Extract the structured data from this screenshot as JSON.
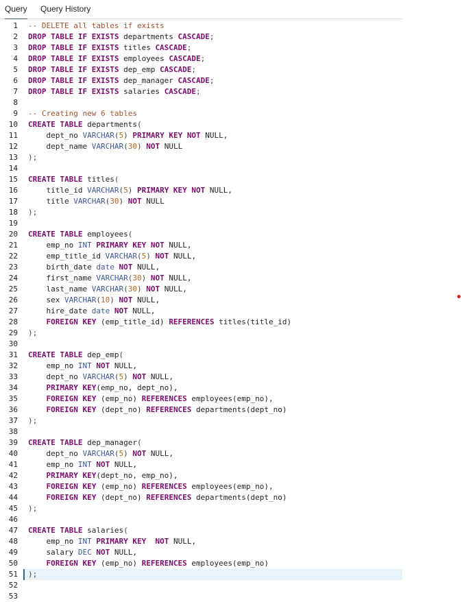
{
  "tabs": [
    {
      "label": "Query",
      "active": true
    },
    {
      "label": "Query History",
      "active": false
    }
  ],
  "editor": {
    "active_line": 51,
    "lines": [
      [
        [
          "cm",
          "-- DELETE all tables if exists"
        ]
      ],
      [
        [
          "kw",
          "DROP TABLE IF EXISTS"
        ],
        [
          "id",
          " departments "
        ],
        [
          "kw",
          "CASCADE"
        ],
        [
          "pn",
          ";"
        ]
      ],
      [
        [
          "kw",
          "DROP TABLE IF EXISTS"
        ],
        [
          "id",
          " titles "
        ],
        [
          "kw",
          "CASCADE"
        ],
        [
          "pn",
          ";"
        ]
      ],
      [
        [
          "kw",
          "DROP TABLE IF EXISTS"
        ],
        [
          "id",
          " employees "
        ],
        [
          "kw",
          "CASCADE"
        ],
        [
          "pn",
          ";"
        ]
      ],
      [
        [
          "kw",
          "DROP TABLE IF EXISTS"
        ],
        [
          "id",
          " dep_emp "
        ],
        [
          "kw",
          "CASCADE"
        ],
        [
          "pn",
          ";"
        ]
      ],
      [
        [
          "kw",
          "DROP TABLE IF EXISTS"
        ],
        [
          "id",
          " dep_manager "
        ],
        [
          "kw",
          "CASCADE"
        ],
        [
          "pn",
          ";"
        ]
      ],
      [
        [
          "kw",
          "DROP TABLE IF EXISTS"
        ],
        [
          "id",
          " salaries "
        ],
        [
          "kw",
          "CASCADE"
        ],
        [
          "pn",
          ";"
        ]
      ],
      [],
      [
        [
          "cm",
          "-- Creating new 6 tables"
        ]
      ],
      [
        [
          "kw",
          "CREATE TABLE"
        ],
        [
          "id",
          " departments"
        ],
        [
          "pn",
          "("
        ]
      ],
      [
        [
          "id",
          "    dept_no "
        ],
        [
          "ty",
          "VARCHAR"
        ],
        [
          "pn",
          "("
        ],
        [
          "num",
          "5"
        ],
        [
          "pn",
          ") "
        ],
        [
          "kw",
          "PRIMARY KEY NOT"
        ],
        [
          "id",
          " NULL,"
        ]
      ],
      [
        [
          "id",
          "    dept_name "
        ],
        [
          "ty",
          "VARCHAR"
        ],
        [
          "pn",
          "("
        ],
        [
          "num",
          "30"
        ],
        [
          "pn",
          ") "
        ],
        [
          "kw",
          "NOT"
        ],
        [
          "id",
          " NULL"
        ]
      ],
      [
        [
          "pn",
          ");"
        ]
      ],
      [],
      [
        [
          "kw",
          "CREATE TABLE"
        ],
        [
          "id",
          " titles"
        ],
        [
          "pn",
          "("
        ]
      ],
      [
        [
          "id",
          "    title_id "
        ],
        [
          "ty",
          "VARCHAR"
        ],
        [
          "pn",
          "("
        ],
        [
          "num",
          "5"
        ],
        [
          "pn",
          ") "
        ],
        [
          "kw",
          "PRIMARY KEY NOT"
        ],
        [
          "id",
          " NULL,"
        ]
      ],
      [
        [
          "id",
          "    title "
        ],
        [
          "ty",
          "VARCHAR"
        ],
        [
          "pn",
          "("
        ],
        [
          "num",
          "30"
        ],
        [
          "pn",
          ") "
        ],
        [
          "kw",
          "NOT"
        ],
        [
          "id",
          " NULL"
        ]
      ],
      [
        [
          "pn",
          ");"
        ]
      ],
      [],
      [
        [
          "kw",
          "CREATE TABLE"
        ],
        [
          "id",
          " employees"
        ],
        [
          "pn",
          "("
        ]
      ],
      [
        [
          "id",
          "    emp_no "
        ],
        [
          "ty",
          "INT"
        ],
        [
          "id",
          " "
        ],
        [
          "kw",
          "PRIMARY KEY NOT"
        ],
        [
          "id",
          " NULL,"
        ]
      ],
      [
        [
          "id",
          "    emp_title_id "
        ],
        [
          "ty",
          "VARCHAR"
        ],
        [
          "pn",
          "("
        ],
        [
          "num",
          "5"
        ],
        [
          "pn",
          ") "
        ],
        [
          "kw",
          "NOT"
        ],
        [
          "id",
          " NULL,"
        ]
      ],
      [
        [
          "id",
          "    birth_date "
        ],
        [
          "ty",
          "date"
        ],
        [
          "id",
          " "
        ],
        [
          "kw",
          "NOT"
        ],
        [
          "id",
          " NULL,"
        ]
      ],
      [
        [
          "id",
          "    first_name "
        ],
        [
          "ty",
          "VARCHAR"
        ],
        [
          "pn",
          "("
        ],
        [
          "num",
          "30"
        ],
        [
          "pn",
          ") "
        ],
        [
          "kw",
          "NOT"
        ],
        [
          "id",
          " NULL,"
        ]
      ],
      [
        [
          "id",
          "    last_name "
        ],
        [
          "ty",
          "VARCHAR"
        ],
        [
          "pn",
          "("
        ],
        [
          "num",
          "30"
        ],
        [
          "pn",
          ") "
        ],
        [
          "kw",
          "NOT"
        ],
        [
          "id",
          " NULL,"
        ]
      ],
      [
        [
          "id",
          "    sex "
        ],
        [
          "ty",
          "VARCHAR"
        ],
        [
          "pn",
          "("
        ],
        [
          "num",
          "10"
        ],
        [
          "pn",
          ") "
        ],
        [
          "kw",
          "NOT"
        ],
        [
          "id",
          " NULL,"
        ]
      ],
      [
        [
          "id",
          "    hire_date "
        ],
        [
          "ty",
          "date"
        ],
        [
          "id",
          " "
        ],
        [
          "kw",
          "NOT"
        ],
        [
          "id",
          " NULL,"
        ]
      ],
      [
        [
          "kw",
          "    FOREIGN KEY"
        ],
        [
          "id",
          " (emp_title_id) "
        ],
        [
          "kw",
          "REFERENCES"
        ],
        [
          "id",
          " titles(title_id)"
        ]
      ],
      [
        [
          "pn",
          ");"
        ]
      ],
      [],
      [
        [
          "kw",
          "CREATE TABLE"
        ],
        [
          "id",
          " dep_emp"
        ],
        [
          "pn",
          "("
        ]
      ],
      [
        [
          "id",
          "    emp_no "
        ],
        [
          "ty",
          "INT"
        ],
        [
          "id",
          " "
        ],
        [
          "kw",
          "NOT"
        ],
        [
          "id",
          " NULL,"
        ]
      ],
      [
        [
          "id",
          "    dept_no "
        ],
        [
          "ty",
          "VARCHAR"
        ],
        [
          "pn",
          "("
        ],
        [
          "num",
          "5"
        ],
        [
          "pn",
          ") "
        ],
        [
          "kw",
          "NOT"
        ],
        [
          "id",
          " NULL,"
        ]
      ],
      [
        [
          "kw",
          "    PRIMARY KEY"
        ],
        [
          "id",
          "(emp_no, dept_no),"
        ]
      ],
      [
        [
          "kw",
          "    FOREIGN KEY"
        ],
        [
          "id",
          " (emp_no) "
        ],
        [
          "kw",
          "REFERENCES"
        ],
        [
          "id",
          " employees(emp_no),"
        ]
      ],
      [
        [
          "kw",
          "    FOREIGN KEY"
        ],
        [
          "id",
          " (dept_no) "
        ],
        [
          "kw",
          "REFERENCES"
        ],
        [
          "id",
          " departments(dept_no)"
        ]
      ],
      [
        [
          "pn",
          ");"
        ]
      ],
      [],
      [
        [
          "kw",
          "CREATE TABLE"
        ],
        [
          "id",
          " dep_manager"
        ],
        [
          "pn",
          "("
        ]
      ],
      [
        [
          "id",
          "    dept_no "
        ],
        [
          "ty",
          "VARCHAR"
        ],
        [
          "pn",
          "("
        ],
        [
          "num",
          "5"
        ],
        [
          "pn",
          ") "
        ],
        [
          "kw",
          "NOT"
        ],
        [
          "id",
          " NULL,"
        ]
      ],
      [
        [
          "id",
          "    emp_no "
        ],
        [
          "ty",
          "INT"
        ],
        [
          "id",
          " "
        ],
        [
          "kw",
          "NOT"
        ],
        [
          "id",
          " NULL,"
        ]
      ],
      [
        [
          "kw",
          "    PRIMARY KEY"
        ],
        [
          "id",
          "(dept_no, emp_no),"
        ]
      ],
      [
        [
          "kw",
          "    FOREIGN KEY"
        ],
        [
          "id",
          " (emp_no) "
        ],
        [
          "kw",
          "REFERENCES"
        ],
        [
          "id",
          " employees(emp_no),"
        ]
      ],
      [
        [
          "kw",
          "    FOREIGN KEY"
        ],
        [
          "id",
          " (dept_no) "
        ],
        [
          "kw",
          "REFERENCES"
        ],
        [
          "id",
          " departments(dept_no)"
        ]
      ],
      [
        [
          "pn",
          ");"
        ]
      ],
      [],
      [
        [
          "kw",
          "CREATE TABLE"
        ],
        [
          "id",
          " salaries"
        ],
        [
          "pn",
          "("
        ]
      ],
      [
        [
          "id",
          "    emp_no "
        ],
        [
          "ty",
          "INT"
        ],
        [
          "id",
          " "
        ],
        [
          "kw",
          "PRIMARY KEY"
        ],
        [
          "id",
          "  "
        ],
        [
          "kw",
          "NOT"
        ],
        [
          "id",
          " NULL,"
        ]
      ],
      [
        [
          "id",
          "    salary "
        ],
        [
          "ty",
          "DEC"
        ],
        [
          "id",
          " "
        ],
        [
          "kw",
          "NOT"
        ],
        [
          "id",
          " NULL,"
        ]
      ],
      [
        [
          "kw",
          "    FOREIGN KEY"
        ],
        [
          "id",
          " (emp_no) "
        ],
        [
          "kw",
          "REFERENCES"
        ],
        [
          "id",
          " employees(emp_no)"
        ]
      ],
      [
        [
          "pn",
          ");"
        ]
      ],
      [],
      []
    ]
  }
}
